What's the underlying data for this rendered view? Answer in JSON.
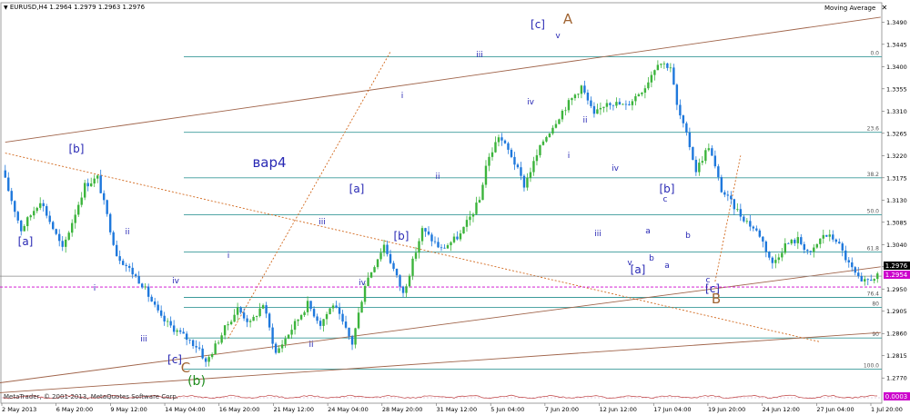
{
  "header": {
    "symbol_line": "EURUSD,H4  1.2964 1.2979 1.2963 1.2976",
    "indicator_name": "Moving Average",
    "close_icon": "close-icon"
  },
  "price_tags": {
    "current": "1.2976",
    "level": "1.2954",
    "indicator_value": "0.0003"
  },
  "copyright": "MetaTrader, © 2001-2013, MetaQuotes Software Corp.",
  "colors": {
    "bull": "#3cb43c",
    "bear": "#1e78dc",
    "fib": "#3a9a9a",
    "channel": "#a0644a",
    "label_blue": "#2828b4",
    "label_brown": "#a06432",
    "label_green": "#1e8c1e",
    "magenta": "#cc00cc"
  },
  "chart_data": {
    "type": "candlestick",
    "title": "EURUSD,H4",
    "ylim": [
      1.273,
      1.352
    ],
    "y_ticks": [
      "1.3490",
      "1.3445",
      "1.3400",
      "1.3355",
      "1.3310",
      "1.3265",
      "1.3220",
      "1.3175",
      "1.3130",
      "1.3085",
      "1.3040",
      "1.2995",
      "1.2950",
      "1.2905",
      "1.2860",
      "1.2815",
      "1.2770"
    ],
    "x_ticks": [
      "2 May 2013",
      "6 May 20:00",
      "9 May 12:00",
      "14 May 04:00",
      "16 May 20:00",
      "21 May 12:00",
      "24 May 04:00",
      "28 May 20:00",
      "31 May 12:00",
      "5 Jun 04:00",
      "7 Jun 20:00",
      "12 Jun 12:00",
      "17 Jun 04:00",
      "19 Jun 20:00",
      "24 Jun 12:00",
      "27 Jun 04:00",
      "1 Jul 20:00"
    ],
    "path": [
      [
        0,
        1.319
      ],
      [
        6,
        1.307
      ],
      [
        12,
        1.313
      ],
      [
        19,
        1.303
      ],
      [
        26,
        1.316
      ],
      [
        30,
        1.3175
      ],
      [
        36,
        1.302
      ],
      [
        44,
        1.296
      ],
      [
        50,
        1.289
      ],
      [
        56,
        1.286
      ],
      [
        62,
        1.283
      ],
      [
        64,
        1.28
      ],
      [
        70,
        1.287
      ],
      [
        74,
        1.291
      ],
      [
        78,
        1.288
      ],
      [
        82,
        1.292
      ],
      [
        86,
        1.282
      ],
      [
        90,
        1.286
      ],
      [
        96,
        1.292
      ],
      [
        100,
        1.288
      ],
      [
        104,
        1.292
      ],
      [
        110,
        1.284
      ],
      [
        114,
        1.296
      ],
      [
        120,
        1.304
      ],
      [
        126,
        1.294
      ],
      [
        132,
        1.307
      ],
      [
        138,
        1.303
      ],
      [
        144,
        1.306
      ],
      [
        150,
        1.313
      ],
      [
        152,
        1.32
      ],
      [
        156,
        1.326
      ],
      [
        160,
        1.322
      ],
      [
        164,
        1.316
      ],
      [
        170,
        1.325
      ],
      [
        176,
        1.331
      ],
      [
        182,
        1.336
      ],
      [
        186,
        1.33
      ],
      [
        190,
        1.333
      ],
      [
        196,
        1.332
      ],
      [
        202,
        1.336
      ],
      [
        206,
        1.341
      ],
      [
        210,
        1.34
      ],
      [
        212,
        1.332
      ],
      [
        216,
        1.324
      ],
      [
        218,
        1.319
      ],
      [
        222,
        1.324
      ],
      [
        226,
        1.315
      ],
      [
        232,
        1.31
      ],
      [
        238,
        1.306
      ],
      [
        242,
        1.3
      ],
      [
        246,
        1.304
      ],
      [
        250,
        1.305
      ],
      [
        254,
        1.302
      ],
      [
        258,
        1.306
      ],
      [
        262,
        1.305
      ],
      [
        266,
        1.3
      ],
      [
        270,
        1.296
      ],
      [
        274,
        1.2975
      ]
    ],
    "n_bars": 275,
    "fib_levels": [
      {
        "label": "0.0",
        "price": 1.342
      },
      {
        "label": "23.6",
        "price": 1.3267
      },
      {
        "label": "38.2",
        "price": 1.3175
      },
      {
        "label": "50.0",
        "price": 1.31
      },
      {
        "label": "61.8",
        "price": 1.3025
      },
      {
        "label": "76.4",
        "price": 1.2933
      },
      {
        "label": "80",
        "price": 1.2913
      },
      {
        "label": "90",
        "price": 1.2851
      },
      {
        "label": "100.0",
        "price": 1.2788
      }
    ],
    "wave_labels": [
      {
        "text": "[a]",
        "color": "blue",
        "size": 12,
        "x": 28,
        "y": 270
      },
      {
        "text": "[b]",
        "color": "blue",
        "size": 12,
        "x": 84,
        "y": 168
      },
      {
        "text": "i",
        "color": "blue",
        "size": 9,
        "x": 104,
        "y": 320
      },
      {
        "text": "ii",
        "color": "blue",
        "size": 9,
        "x": 140,
        "y": 258
      },
      {
        "text": "iii",
        "color": "blue",
        "size": 9,
        "x": 158,
        "y": 376
      },
      {
        "text": "iv",
        "color": "blue",
        "size": 9,
        "x": 193,
        "y": 312
      },
      {
        "text": "[c]",
        "color": "blue",
        "size": 12,
        "x": 192,
        "y": 400
      },
      {
        "text": "C",
        "color": "brown",
        "size": 15,
        "x": 204,
        "y": 410
      },
      {
        "text": "(b)",
        "color": "green",
        "size": 14,
        "x": 216,
        "y": 424
      },
      {
        "text": "i",
        "color": "blue",
        "size": 9,
        "x": 251,
        "y": 284
      },
      {
        "text": "ii",
        "color": "blue",
        "size": 9,
        "x": 342,
        "y": 382
      },
      {
        "text": "iii",
        "color": "blue",
        "size": 9,
        "x": 354,
        "y": 247
      },
      {
        "text": "iv",
        "color": "blue",
        "size": 9,
        "x": 398,
        "y": 314
      },
      {
        "text": "[a]",
        "color": "blue",
        "size": 12,
        "x": 392,
        "y": 212
      },
      {
        "text": "[b]",
        "color": "blue",
        "size": 12,
        "x": 441,
        "y": 264
      },
      {
        "text": "вар4",
        "color": "blue",
        "size": 15,
        "x": 296,
        "y": 184
      },
      {
        "text": "i",
        "color": "blue",
        "size": 9,
        "x": 442,
        "y": 108
      },
      {
        "text": "ii",
        "color": "blue",
        "size": 9,
        "x": 481,
        "y": 197
      },
      {
        "text": "iii",
        "color": "blue",
        "size": 9,
        "x": 527,
        "y": 63
      },
      {
        "text": "iv",
        "color": "blue",
        "size": 9,
        "x": 583,
        "y": 115
      },
      {
        "text": "[c]",
        "color": "blue",
        "size": 12,
        "x": 591,
        "y": 31
      },
      {
        "text": "A",
        "color": "brown",
        "size": 15,
        "x": 624,
        "y": 26
      },
      {
        "text": "v",
        "color": "blue",
        "size": 9,
        "x": 613,
        "y": 42
      },
      {
        "text": "i",
        "color": "blue",
        "size": 9,
        "x": 625,
        "y": 174
      },
      {
        "text": "ii",
        "color": "blue",
        "size": 9,
        "x": 643,
        "y": 135
      },
      {
        "text": "iii",
        "color": "blue",
        "size": 9,
        "x": 657,
        "y": 260
      },
      {
        "text": "iv",
        "color": "blue",
        "size": 9,
        "x": 676,
        "y": 188
      },
      {
        "text": "v",
        "color": "blue",
        "size": 9,
        "x": 692,
        "y": 292
      },
      {
        "text": "[a]",
        "color": "blue",
        "size": 12,
        "x": 701,
        "y": 301
      },
      {
        "text": "a",
        "color": "blue",
        "size": 9,
        "x": 712,
        "y": 257
      },
      {
        "text": "b",
        "color": "blue",
        "size": 9,
        "x": 716,
        "y": 287
      },
      {
        "text": "[b]",
        "color": "blue",
        "size": 12,
        "x": 733,
        "y": 212
      },
      {
        "text": "c",
        "color": "blue",
        "size": 9,
        "x": 731,
        "y": 222
      },
      {
        "text": "a",
        "color": "blue",
        "size": 9,
        "x": 733,
        "y": 295
      },
      {
        "text": "b",
        "color": "blue",
        "size": 9,
        "x": 756,
        "y": 262
      },
      {
        "text": "c",
        "color": "blue",
        "size": 9,
        "x": 778,
        "y": 311
      },
      {
        "text": "[c]",
        "color": "blue",
        "size": 12,
        "x": 783,
        "y": 322
      },
      {
        "text": "B",
        "color": "brown",
        "size": 15,
        "x": 787,
        "y": 334
      }
    ]
  }
}
